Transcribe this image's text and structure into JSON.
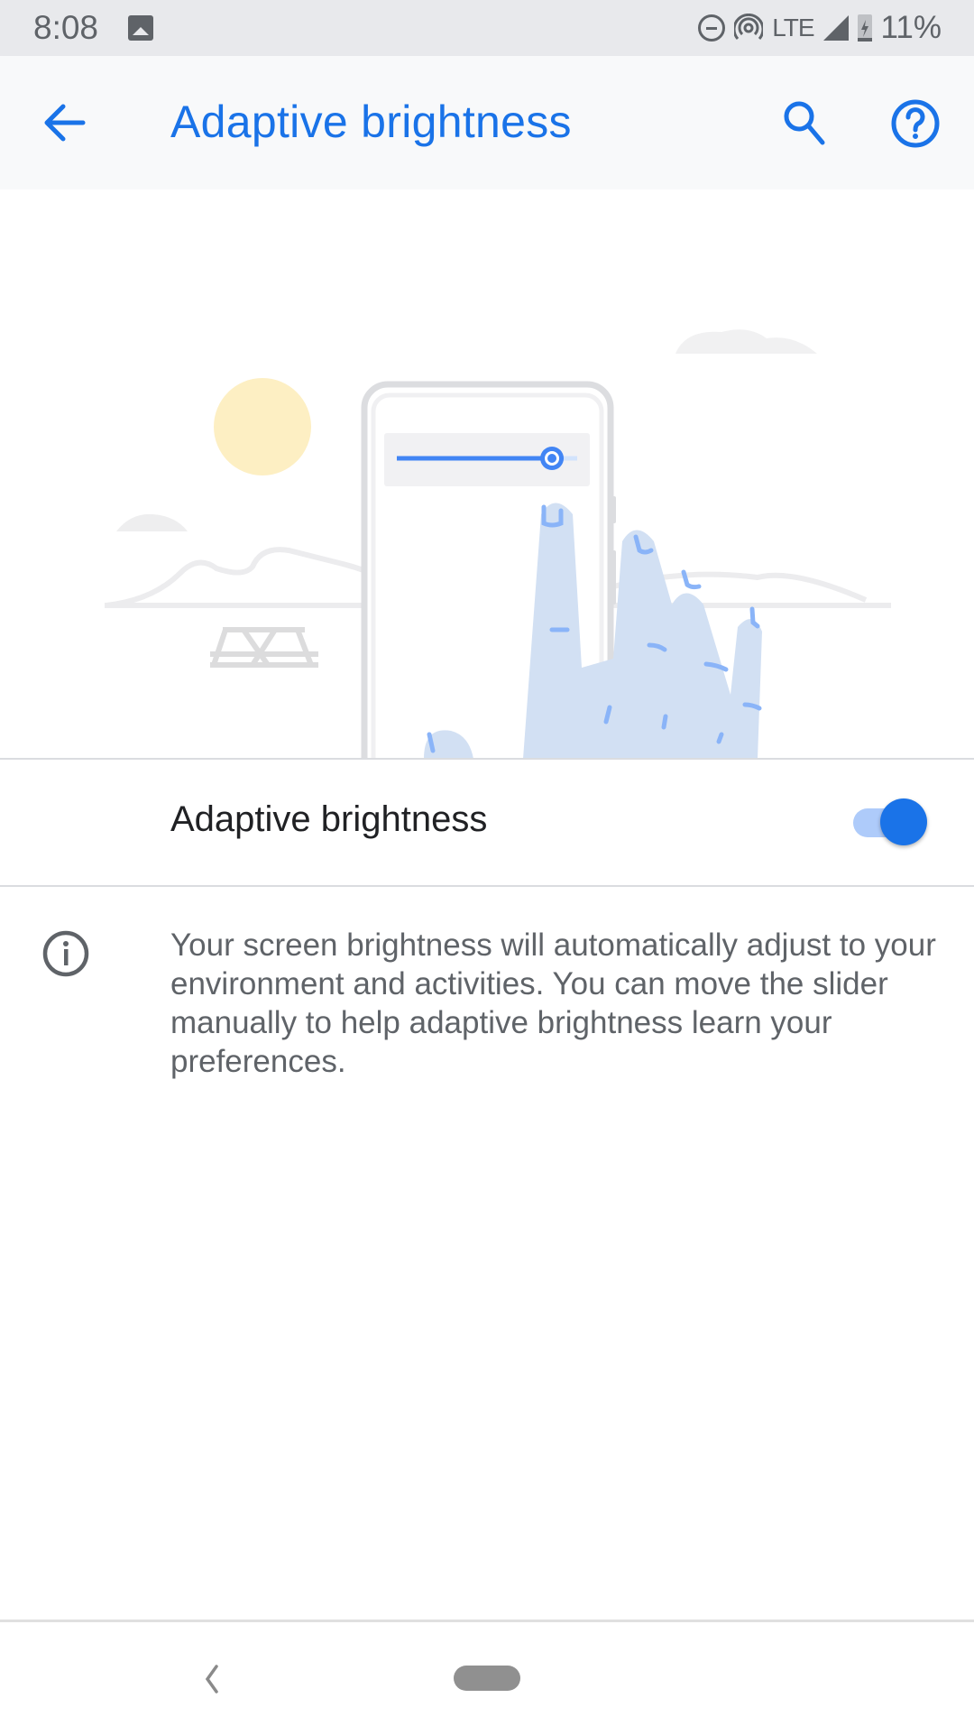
{
  "status_bar": {
    "time": "8:08",
    "notification_icon": "image-icon",
    "icons": [
      "do-not-disturb-icon",
      "hotspot-icon",
      "signal-icon",
      "battery-charging-icon"
    ],
    "network": "LTE",
    "battery": "11%"
  },
  "app_bar": {
    "title": "Adaptive brightness",
    "back_icon": "arrow-back-icon",
    "search_icon": "search-icon",
    "help_icon": "help-icon"
  },
  "illustration": {
    "description": "phone with brightness slider and hand",
    "slider_level": 0.92,
    "colors": {
      "sun": "#fdefc3",
      "hand": "#d2e0f3",
      "accent": "#1a73e8",
      "scenery": "#efeff0"
    }
  },
  "setting": {
    "label": "Adaptive brightness",
    "enabled": true,
    "accent_color": "#1a73e8"
  },
  "info": {
    "icon": "info-icon",
    "text": "Your screen brightness will automatically adjust to your environment and activities. You can move the slider manually to help adaptive brightness learn your preferences."
  },
  "nav_bar": {
    "back_icon": "nav-back-icon",
    "home_icon": "home-pill-icon"
  }
}
